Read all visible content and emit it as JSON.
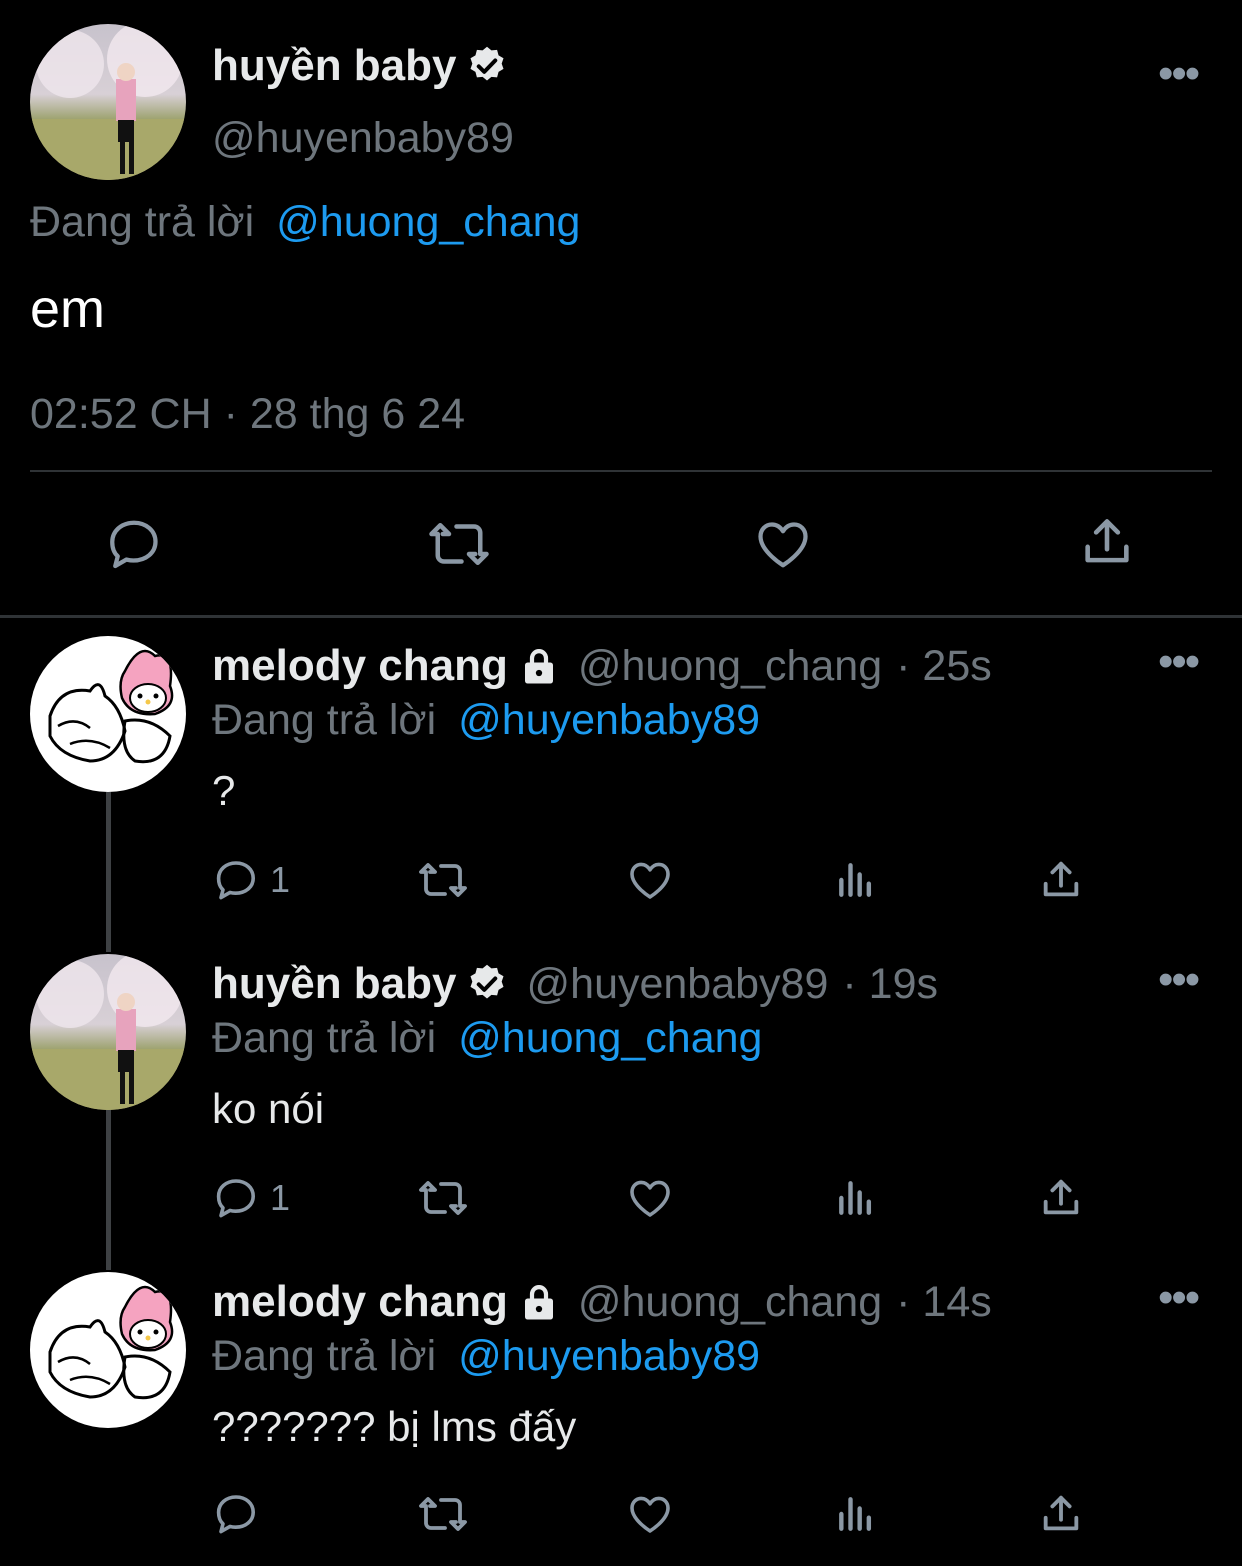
{
  "main_tweet": {
    "name": "huyền baby",
    "handle": "@huyenbaby89",
    "replying_label": "Đang trả lời",
    "replying_to": "@huong_chang",
    "text": "em",
    "timestamp": "02:52 CH · 28 thg 6 24"
  },
  "replies": [
    {
      "name": "melody chang",
      "handle": "@huong_chang",
      "time": "· 25s",
      "replying_label": "Đang trả lời",
      "replying_to": "@huyenbaby89",
      "text": "?",
      "reply_count": "1"
    },
    {
      "name": "huyền baby",
      "handle": "@huyenbaby89",
      "time": "· 19s",
      "replying_label": "Đang trả lời",
      "replying_to": "@huong_chang",
      "text": "ko nói",
      "reply_count": "1"
    },
    {
      "name": "melody chang",
      "handle": "@huong_chang",
      "time": "· 14s",
      "replying_label": "Đang trả lời",
      "replying_to": "@huyenbaby89",
      "text": "??????? bị lms đấy",
      "reply_count": ""
    }
  ],
  "colors": {
    "background": "#000000",
    "text": "#e7e9ea",
    "muted": "#6e767d",
    "link": "#1d9bf0"
  },
  "icons": [
    "verified-badge-icon",
    "lock-icon",
    "more-icon",
    "reply-icon",
    "retweet-icon",
    "like-icon",
    "views-icon",
    "share-icon"
  ]
}
